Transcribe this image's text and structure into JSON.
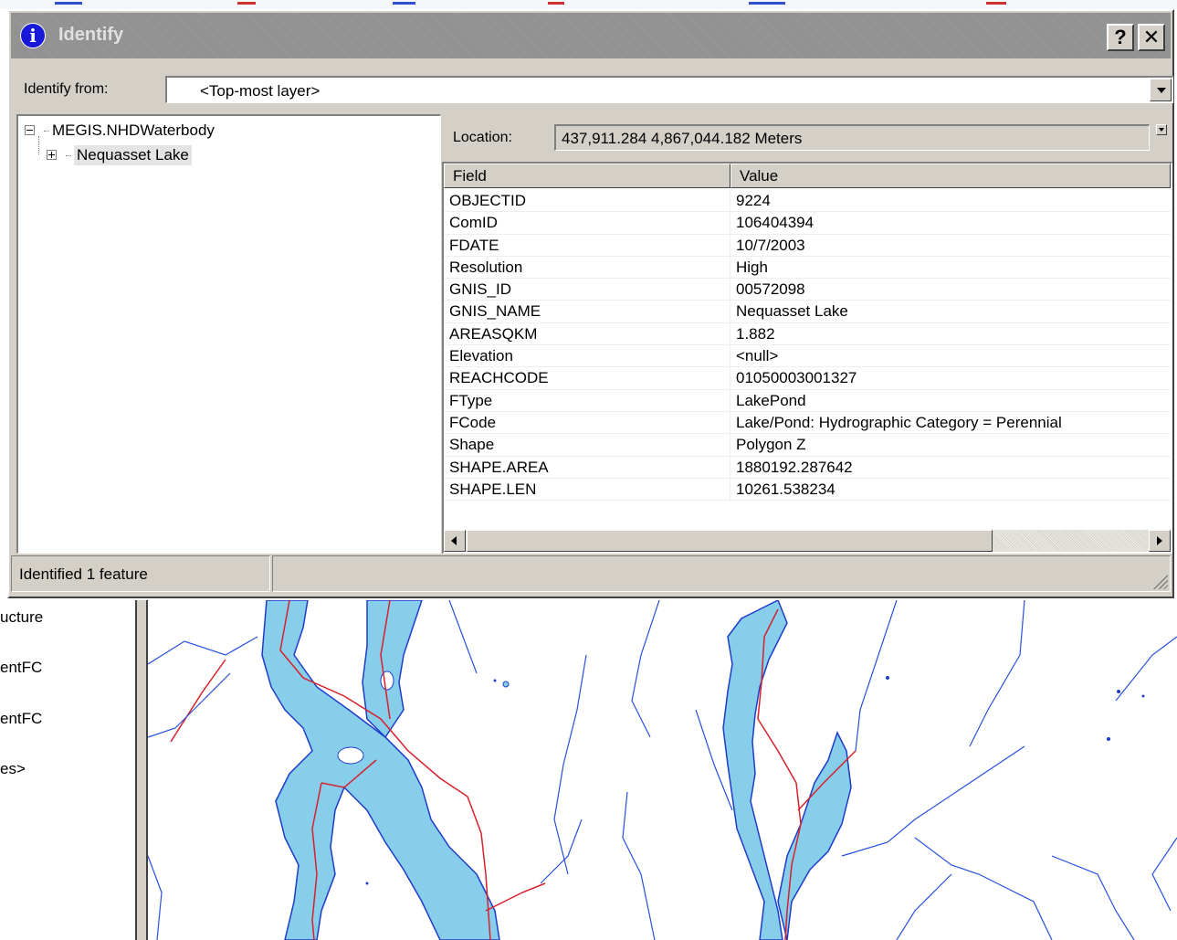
{
  "dialog": {
    "title": "Identify",
    "help_label": "?",
    "close_label": "✕",
    "identify_from_label": "Identify from:",
    "identify_from_value": "<Top-most layer>"
  },
  "tree": {
    "root_label": "MEGIS.NHDWaterbody",
    "child_label": "Nequasset Lake"
  },
  "location": {
    "label": "Location:",
    "value": "437,911.284  4,867,044.182 Meters"
  },
  "attribute_grid": {
    "columns": [
      "Field",
      "Value"
    ],
    "rows": [
      {
        "field": "OBJECTID",
        "value": "9224"
      },
      {
        "field": "ComID",
        "value": "106404394"
      },
      {
        "field": "FDATE",
        "value": "10/7/2003"
      },
      {
        "field": "Resolution",
        "value": "High"
      },
      {
        "field": "GNIS_ID",
        "value": "00572098"
      },
      {
        "field": "GNIS_NAME",
        "value": "Nequasset Lake"
      },
      {
        "field": "AREASQKM",
        "value": "1.882"
      },
      {
        "field": "Elevation",
        "value": "<null>"
      },
      {
        "field": "REACHCODE",
        "value": "01050003001327"
      },
      {
        "field": "FType",
        "value": "LakePond"
      },
      {
        "field": "FCode",
        "value": "Lake/Pond: Hydrographic Category = Perennial"
      },
      {
        "field": "Shape",
        "value": "Polygon Z"
      },
      {
        "field": "SHAPE.AREA",
        "value": "1880192.287642"
      },
      {
        "field": "SHAPE.LEN",
        "value": "10261.538234"
      }
    ]
  },
  "status": {
    "text": "Identified 1 feature"
  },
  "toc_partial": [
    "ucture",
    "entFC",
    "entFC",
    "es>"
  ],
  "colors": {
    "water_fill": "#87ceeb",
    "water_edge": "#1e3cc8",
    "flowline": "#d8202c",
    "stream": "#2850e0"
  },
  "icons": {
    "title_icon": "info-icon",
    "tree_expand": "tree-expander-icon"
  }
}
